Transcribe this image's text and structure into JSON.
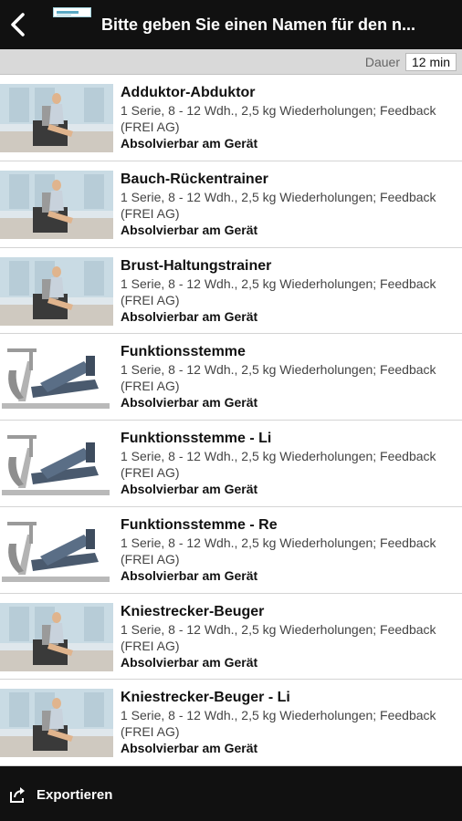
{
  "header": {
    "back_icon": "chevron-left-icon",
    "logo": "app-logo",
    "title": "Bitte geben Sie einen Namen für den n..."
  },
  "duration": {
    "label": "Dauer",
    "value": "12 min"
  },
  "exercises": [
    {
      "name": "Adduktor-Abduktor",
      "detail": "1 Serie, 8 - 12 Wdh., 2,5 kg Wiederholungen; Feedback (FREI AG)",
      "status": "Absolvierbar am Gerät",
      "image": "room"
    },
    {
      "name": "Bauch-Rückentrainer",
      "detail": "1 Serie, 8 - 12 Wdh., 2,5 kg Wiederholungen; Feedback (FREI AG)",
      "status": "Absolvierbar am Gerät",
      "image": "room"
    },
    {
      "name": "Brust-Haltungstrainer",
      "detail": "1 Serie, 8 - 12 Wdh., 2,5 kg Wiederholungen; Feedback (FREI AG)",
      "status": "Absolvierbar am Gerät",
      "image": "room"
    },
    {
      "name": "Funktionsstemme",
      "detail": "1 Serie, 8 - 12 Wdh., 2,5 kg Wiederholungen; Feedback (FREI AG)",
      "status": "Absolvierbar am Gerät",
      "image": "machine"
    },
    {
      "name": "Funktionsstemme - Li",
      "detail": "1 Serie, 8 - 12 Wdh., 2,5 kg Wiederholungen; Feedback (FREI AG)",
      "status": "Absolvierbar am Gerät",
      "image": "machine"
    },
    {
      "name": "Funktionsstemme - Re",
      "detail": "1 Serie, 8 - 12 Wdh., 2,5 kg Wiederholungen; Feedback (FREI AG)",
      "status": "Absolvierbar am Gerät",
      "image": "machine"
    },
    {
      "name": "Kniestrecker-Beuger",
      "detail": "1 Serie, 8 - 12 Wdh., 2,5 kg Wiederholungen; Feedback (FREI AG)",
      "status": "Absolvierbar am Gerät",
      "image": "room"
    },
    {
      "name": "Kniestrecker-Beuger - Li",
      "detail": "1 Serie, 8 - 12 Wdh., 2,5 kg Wiederholungen; Feedback (FREI AG)",
      "status": "Absolvierbar am Gerät",
      "image": "room"
    }
  ],
  "footer": {
    "export_label": "Exportieren",
    "export_icon": "share-export-icon"
  }
}
